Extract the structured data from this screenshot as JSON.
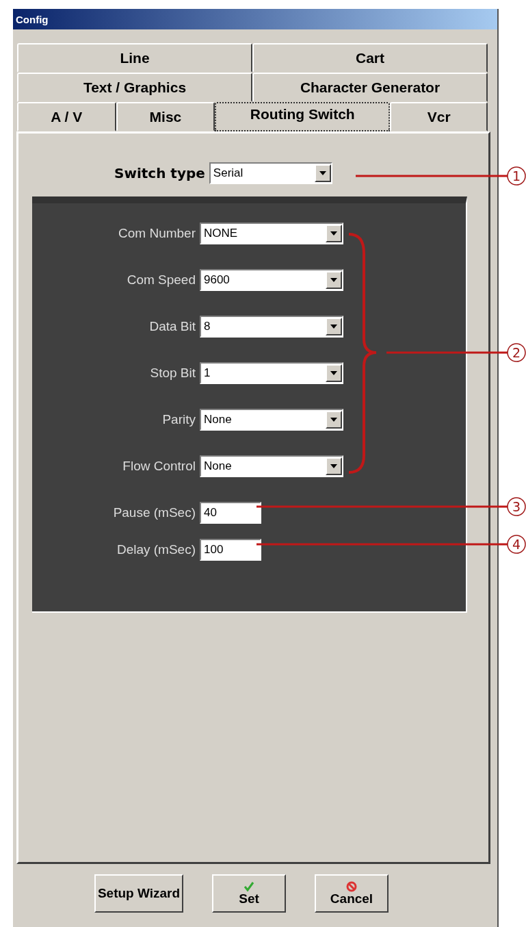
{
  "window": {
    "title": "Config"
  },
  "tab_rows": [
    [
      {
        "label": "Line",
        "selected": false
      },
      {
        "label": "Cart",
        "selected": false
      }
    ],
    [
      {
        "label": "Text / Graphics",
        "selected": false
      },
      {
        "label": "Character Generator",
        "selected": false
      }
    ],
    [
      {
        "label": "A / V",
        "selected": false
      },
      {
        "label": "Misc",
        "selected": false
      },
      {
        "label": "Routing Switch",
        "selected": true
      },
      {
        "label": "Vcr",
        "selected": false
      }
    ]
  ],
  "switch_type": {
    "label": "Switch type",
    "value": "Serial"
  },
  "serial_settings": [
    {
      "label": "Com Number",
      "value": "NONE",
      "kind": "combo"
    },
    {
      "label": "Com Speed",
      "value": "9600",
      "kind": "combo"
    },
    {
      "label": "Data Bit",
      "value": "8",
      "kind": "combo"
    },
    {
      "label": "Stop Bit",
      "value": "1",
      "kind": "combo"
    },
    {
      "label": "Parity",
      "value": "None",
      "kind": "combo"
    },
    {
      "label": "Flow Control",
      "value": "None",
      "kind": "combo"
    },
    {
      "label": "Pause (mSec)",
      "value": "40",
      "kind": "text"
    },
    {
      "label": "Delay (mSec)",
      "value": "100",
      "kind": "text"
    }
  ],
  "callouts": [
    "1",
    "2",
    "3",
    "4"
  ],
  "buttons": [
    {
      "label": "Setup Wizard",
      "kind": "text"
    },
    {
      "label": "Set",
      "kind": "check"
    },
    {
      "label": "Cancel",
      "kind": "cancel"
    }
  ]
}
